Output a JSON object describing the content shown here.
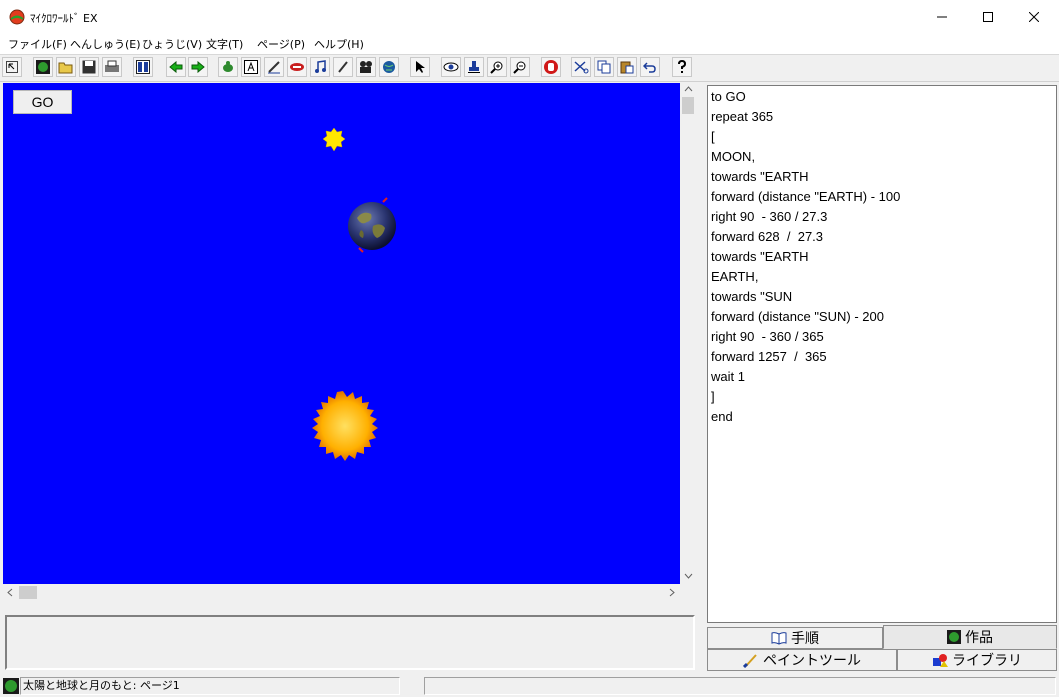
{
  "window": {
    "title": "ﾏｲｸﾛﾜｰﾙﾄﾞ EX"
  },
  "menu": [
    "ファイル(F)",
    "へんしゅう(E)",
    "ひょうじ(V)",
    "文字(T)",
    "ページ(P)",
    "ヘルプ(H)"
  ],
  "toolbar": {
    "icons": [
      "arrow-cursor-icon",
      "globe-icon",
      "open-folder-icon",
      "save-icon",
      "print-icon",
      "page-list-icon",
      "back-arrow-icon",
      "forward-arrow-icon",
      "turtle-icon",
      "text-box-icon",
      "pen-icon",
      "button-icon",
      "music-note-icon",
      "brush-icon",
      "movie-icon",
      "world-icon",
      "pointer-icon",
      "eye-icon",
      "stamp-icon",
      "zoom-in-icon",
      "zoom-out-icon",
      "stop-hand-icon",
      "scissors-icon",
      "copy-icon",
      "paste-icon",
      "undo-icon",
      "help-icon"
    ]
  },
  "stage": {
    "go_button_label": "GO",
    "background": "#0000fe"
  },
  "code": {
    "lines": [
      "to GO",
      "repeat 365",
      "[",
      "MOON,",
      "towards \"EARTH",
      "forward (distance \"EARTH) - 100",
      "right 90  - 360 / 27.3",
      "forward 628  /  27.3",
      "towards \"EARTH",
      "EARTH,",
      "towards \"SUN",
      "forward (distance \"SUN) - 200",
      "right 90  - 360 / 365",
      "forward 1257  /  365",
      "wait 1",
      "]",
      "end"
    ]
  },
  "tabs": {
    "procedures": "手順",
    "works": "作品",
    "paint_tools": "ペイントツール",
    "library": "ライブラリ"
  },
  "status": {
    "text": "太陽と地球と月のもと: ページ1"
  }
}
